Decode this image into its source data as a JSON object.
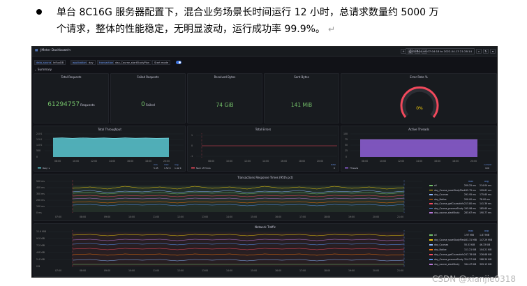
{
  "document": {
    "line1": "单台 8C16G 服务器配置下，混合业务场景长时间运行 12 小时，总请求数量约 5000 万",
    "line2": "个请求，整体的性能稳定，无明显波动，运行成功率 99.9%。",
    "return_mark": "↵"
  },
  "grafana": {
    "breadcrumb": "JMeter Dashboard",
    "star": "☆",
    "share": "<",
    "time_range": "2022-04-13 07:04:18 to 2022-04-13 21:28:14",
    "variables": [
      {
        "label": "data_source",
        "value": "InfluxDB"
      },
      {
        "label": "application",
        "value": "day"
      },
      {
        "label": "transaction",
        "value": "day_Course_startStudyPlan"
      },
      {
        "label": "Start mode",
        "value": ""
      }
    ],
    "row_summary": "Summary",
    "stats": {
      "total_requests": {
        "title": "Total Requests",
        "value": "61294757",
        "unit": "Requests"
      },
      "failed_requests": {
        "title": "Failed Requests",
        "value": "0",
        "unit": "Failed"
      },
      "received_bytes": {
        "title": "Received Bytes",
        "value": "74 GiB"
      },
      "sent_bytes": {
        "title": "Sent Bytes",
        "value": "141 MiB"
      },
      "error_rate": {
        "title": "Error Rate %",
        "value": "0%"
      }
    },
    "throughput": {
      "title": "Total Throughput",
      "yticks": [
        "2.0 K",
        "1.5 K",
        "1.0 K",
        "500",
        "0"
      ],
      "xticks": [
        "08:00",
        "10:00",
        "12:00",
        "14:00",
        "16:00",
        "18:00",
        "20:00"
      ],
      "legend": "Req / s",
      "stats_header": [
        "min",
        "max",
        "avg"
      ],
      "stats_values": [
        "5.45",
        "1.52 K",
        "1.42 K"
      ]
    },
    "errors": {
      "title": "Total Errors",
      "yticks": [
        "1",
        "0",
        "-1"
      ],
      "xticks": [
        "08:00",
        "10:00",
        "12:00",
        "14:00",
        "16:00",
        "18:00",
        "20:00"
      ],
      "legend": "Num of Errors",
      "stats_header": [
        "total"
      ],
      "stats_values": [
        "0"
      ]
    },
    "threads": {
      "title": "Active Threads",
      "yticks": [
        "100",
        "75",
        "50",
        "25",
        "0"
      ],
      "xticks": [
        "08:00",
        "10:00",
        "12:00",
        "14:00",
        "16:00",
        "18:00",
        "20:00"
      ],
      "legend": "Threads",
      "stats_header": [
        "current"
      ],
      "stats_values": [
        "100"
      ]
    },
    "response_times": {
      "title": "Transactions Response Times (95th pct)",
      "yticks": [
        "500 ms",
        "400 ms",
        "300 ms",
        "200 ms",
        "100 ms",
        "0 ms"
      ],
      "xticks": [
        "07:00",
        "08:00",
        "09:00",
        "10:00",
        "11:00",
        "12:00",
        "13:00",
        "14:00",
        "15:00",
        "16:00",
        "17:00",
        "18:00",
        "19:00",
        "20:00",
        "21:00"
      ],
      "legend_header": [
        "max",
        "avg"
      ],
      "legend": [
        {
          "name": "all",
          "max": "209.25 ms",
          "avg": "214.04 ms",
          "color": "#73bf69"
        },
        {
          "name": "day_Course_saveStudyPlan",
          "max": "242.75 ms",
          "avg": "199.61 ms",
          "color": "#f2cc0c"
        },
        {
          "name": "day_Courses",
          "max": "291.95 ms",
          "avg": "175.60 ms",
          "color": "#8ab8ff"
        },
        {
          "name": "day_Notice",
          "max": "200.00 ms",
          "avg": "78.00 ms",
          "color": "#ff780a"
        },
        {
          "name": "day_Course_getCourseInfo",
          "max": "213.80 ms",
          "avg": "141.39 ms",
          "color": "#f2495c"
        },
        {
          "name": "day_Course_processStudy",
          "max": "195.98 ms",
          "avg": "185.60 ms",
          "color": "#5794f2"
        },
        {
          "name": "day_course_startStudy",
          "max": "283.67 ms",
          "avg": "190.77 ms",
          "color": "#b877d9"
        }
      ]
    },
    "network": {
      "title": "Network Traffic",
      "yticks": [
        "11.9 MiB",
        "9.5 MiB",
        "7.2 MiB",
        "4.8 MiB",
        "2.4 MiB",
        "0 B"
      ],
      "xticks": [
        "07:00",
        "08:00",
        "09:00",
        "10:00",
        "11:00",
        "12:00",
        "13:00",
        "14:00",
        "15:00",
        "16:00",
        "17:00",
        "18:00",
        "19:00",
        "20:00",
        "21:00"
      ],
      "legend_header": [
        "max",
        "avg"
      ],
      "legend": [
        {
          "name": "all",
          "max": "1.97 MiB",
          "avg": "1.87 MiB",
          "color": "#73bf69"
        },
        {
          "name": "day_Course_saveStudyPlan",
          "max": "161.31 MiB",
          "avg": "147.29 MiB",
          "color": "#f2cc0c"
        },
        {
          "name": "day_Courses",
          "max": "55.53 KiB",
          "avg": "46.33 KiB",
          "color": "#8ab8ff"
        },
        {
          "name": "day_Notice",
          "max": "111.21 KiB",
          "avg": "104.21 KiB",
          "color": "#ff780a"
        },
        {
          "name": "day_Course_getCourseInfo",
          "max": "247.78 KiB",
          "avg": "226.68 KiB",
          "color": "#f2495c"
        },
        {
          "name": "day_Course_processStudy",
          "max": "314.27 KiB",
          "avg": "288.39 KiB",
          "color": "#5794f2"
        },
        {
          "name": "day_course_startStudy",
          "max": "344.47 KiB",
          "avg": "309.13 KiB",
          "color": "#b877d9"
        }
      ]
    }
  },
  "watermark": "CSDN @xianjie0318",
  "colors": {
    "green": "#73bf69",
    "teal": "#5ac8d2",
    "purple": "#8f5fd8",
    "bg": "#111217",
    "panel": "#181b1f"
  }
}
